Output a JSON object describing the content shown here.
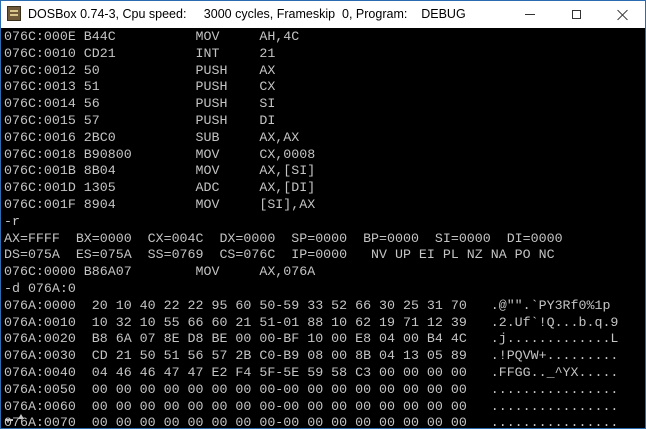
{
  "window": {
    "title": "DOSBox 0.74-3, Cpu speed:     3000 cycles, Frameskip  0, Program:    DEBUG",
    "icon": "dosbox-app-icon",
    "controls": {
      "minimize_icon": "minimize-icon",
      "maximize_icon": "maximize-icon",
      "close_icon": "close-icon"
    }
  },
  "console": {
    "foreground": "#c4c4c4",
    "background": "#000000",
    "lines": [
      "076C:000E B44C          MOV     AH,4C",
      "076C:0010 CD21          INT     21",
      "076C:0012 50            PUSH    AX",
      "076C:0013 51            PUSH    CX",
      "076C:0014 56            PUSH    SI",
      "076C:0015 57            PUSH    DI",
      "076C:0016 2BC0          SUB     AX,AX",
      "076C:0018 B90800        MOV     CX,0008",
      "076C:001B 8B04          MOV     AX,[SI]",
      "076C:001D 1305          ADC     AX,[DI]",
      "076C:001F 8904          MOV     [SI],AX",
      "-r",
      "AX=FFFF  BX=0000  CX=004C  DX=0000  SP=0000  BP=0000  SI=0000  DI=0000",
      "DS=075A  ES=075A  SS=0769  CS=076C  IP=0000   NV UP EI PL NZ NA PO NC",
      "076C:0000 B86A07        MOV     AX,076A",
      "-d 076A:0",
      "076A:0000  20 10 40 22 22 95 60 50-59 33 52 66 30 25 31 70   .@\"\".`PY3Rf0%1p",
      "076A:0010  10 32 10 55 66 60 21 51-01 88 10 62 19 71 12 39   .2.Uf`!Q...b.q.9",
      "076A:0020  B8 6A 07 8E D8 BE 00 00-BF 10 00 E8 04 00 B4 4C   .j.............L",
      "076A:0030  CD 21 50 51 56 57 2B C0-B9 08 00 8B 04 13 05 89   .!PQVW+.........",
      "076A:0040  04 46 46 47 47 E2 F4 5F-5E 59 58 C3 00 00 00 00   .FFGG.._^YX.....",
      "076A:0050  00 00 00 00 00 00 00 00-00 00 00 00 00 00 00 00   ................",
      "076A:0060  00 00 00 00 00 00 00 00-00 00 00 00 00 00 00 00   ................",
      "076A:0070  00 00 00 00 00 00 00 00-00 00 00 00 00 00 00 00   ................",
      "-"
    ]
  }
}
